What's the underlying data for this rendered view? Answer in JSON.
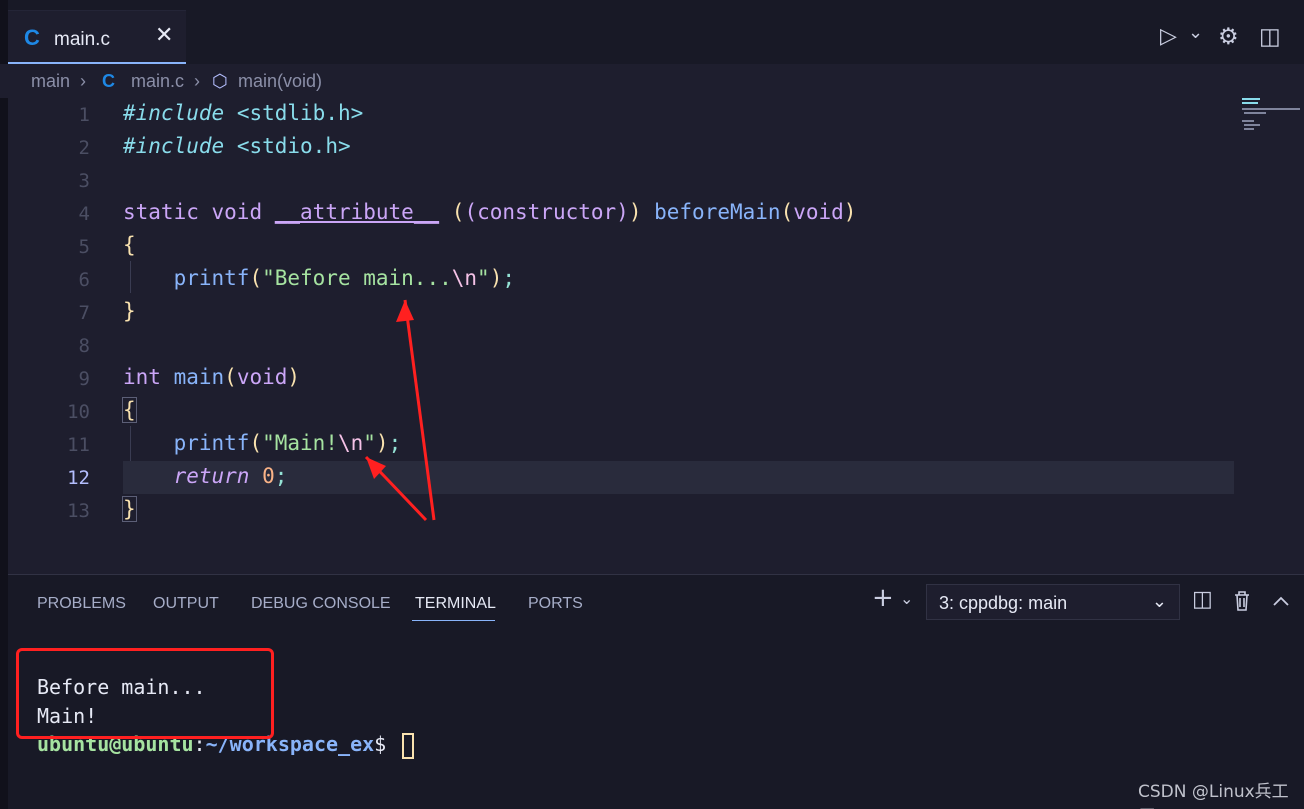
{
  "tab": {
    "label": "main.c",
    "lang_icon": "C",
    "close": "✕"
  },
  "toolbar": {
    "run_icon": "▷",
    "run_dropdown": "⌄",
    "settings_icon": "⚙",
    "split_icon": "◫"
  },
  "breadcrumb": {
    "folder": "main",
    "sep": "›",
    "file": "main.c",
    "symbol": "main(void)",
    "symbol_icon": "⬡"
  },
  "code": {
    "line_numbers": [
      "1",
      "2",
      "3",
      "4",
      "5",
      "6",
      "7",
      "8",
      "9",
      "10",
      "11",
      "12",
      "13"
    ],
    "active_line": 12
  },
  "panel": {
    "tabs": [
      "PROBLEMS",
      "OUTPUT",
      "DEBUG CONSOLE",
      "TERMINAL",
      "PORTS"
    ],
    "active_tab": "TERMINAL",
    "terminal_select": "3: cppdbg: main",
    "add_icon": "+",
    "terminal": {
      "line1": "Before main...",
      "line2": "Main!",
      "prompt_user": "ubuntu@ubuntu",
      "prompt_sep": ":",
      "prompt_path": "~/workspace_ex",
      "prompt_symbol": "$"
    }
  },
  "watermark": "CSDN @Linux兵工厂",
  "colors": {
    "annotation": "#ff2020",
    "accent": "#89b4fa"
  }
}
